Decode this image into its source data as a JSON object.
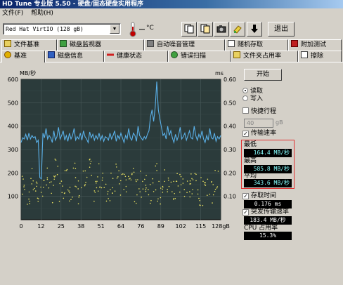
{
  "window": {
    "title": "HD Tune 专业版 5.50 - 硬盘/固态硬盘实用程序"
  },
  "menu": [
    "文件(F)",
    "帮助(H)"
  ],
  "toolbar": {
    "drive": "Red Hat VirtIO (128 gB)",
    "temp_unit": "°C",
    "exit_label": "退出",
    "icons": [
      "copy-info-icon",
      "copy-screenshot-icon",
      "camera-icon",
      "save-icon",
      "download-icon"
    ]
  },
  "tabs_top": [
    "文件基准",
    "磁盘监视器",
    "自动噪音管理",
    "随机存取",
    "附加测试"
  ],
  "tabs_bottom": [
    "基准",
    "磁盘信息",
    "健康状态",
    "错误扫描",
    "文件夹占用率",
    "擦除"
  ],
  "controls": {
    "start_label": "开始",
    "read_label": "读取",
    "write_label": "写入",
    "short_stroke_label": "快捷行程",
    "short_stroke_value": "40",
    "short_stroke_unit": "gB",
    "transfer_rate_label": "传输速率",
    "min_label": "最低",
    "min_value": "164.4 MB/秒",
    "max_label": "最高",
    "max_value": "585.8 MB/秒",
    "avg_label": "平均",
    "avg_value": "343.6 MB/秒",
    "access_time_label": "存取时间",
    "access_time_value": "0.176 ms",
    "burst_rate_label": "突发传输速率",
    "burst_rate_value": "183.4 MB/秒",
    "cpu_label": "CPU 占用率",
    "cpu_value": "15.3%"
  },
  "chart_data": {
    "type": "line",
    "xlabel": "",
    "ylabel": "MB/秒",
    "ylabel_right": "ms",
    "x_unit": "gB",
    "xlim": [
      0,
      128
    ],
    "ylim": [
      0,
      600
    ],
    "y2lim": [
      0,
      0.6
    ],
    "x_ticks": [
      "0",
      "12",
      "25",
      "38",
      "51",
      "64",
      "76",
      "89",
      "102",
      "115",
      "128gB"
    ],
    "y_ticks": [
      "600",
      "500",
      "400",
      "300",
      "200",
      "100"
    ],
    "y2_ticks": [
      "0.60",
      "0.50",
      "0.40",
      "0.30",
      "0.20",
      "0.10"
    ],
    "grid": true,
    "background": "#2b3b3b",
    "series": [
      {
        "color": "#5ab0e8",
        "x": [
          0,
          1,
          2,
          3,
          4,
          5,
          6,
          7,
          8,
          9,
          10,
          11,
          12,
          13,
          14,
          15,
          16,
          17,
          18,
          19,
          20,
          21,
          22,
          23,
          24,
          25,
          26,
          27,
          28,
          29,
          30,
          31,
          32,
          33,
          34,
          35,
          36,
          37,
          38,
          39,
          40,
          41,
          42,
          43,
          44,
          45,
          46,
          47,
          48,
          49,
          50,
          51,
          52,
          53,
          54,
          55,
          56,
          57,
          58,
          59,
          60,
          61,
          62,
          63,
          64,
          65,
          66,
          67,
          68,
          69,
          70,
          71,
          72,
          73,
          74,
          75,
          76,
          77,
          78,
          79,
          80,
          81,
          82,
          83,
          84,
          85,
          86,
          87,
          88,
          89,
          90,
          91,
          92,
          93,
          94,
          95,
          96,
          97,
          98,
          99,
          100,
          101,
          102,
          103,
          104,
          105,
          106,
          107,
          108,
          109,
          110,
          111,
          112,
          113,
          114,
          115,
          116,
          117,
          118,
          119,
          120,
          121,
          122,
          123,
          124,
          125,
          126,
          127,
          128
        ],
        "values": [
          330,
          350,
          345,
          365,
          340,
          370,
          345,
          360,
          350,
          355,
          330,
          340,
          180,
          175,
          370,
          350,
          390,
          345,
          360,
          350,
          330,
          380,
          340,
          355,
          395,
          345,
          360,
          380,
          340,
          360,
          335,
          370,
          345,
          360,
          390,
          340,
          355,
          345,
          370,
          340,
          380,
          355,
          345,
          330,
          375,
          350,
          365,
          340,
          360,
          345,
          370,
          340,
          360,
          335,
          355,
          350,
          340,
          370,
          345,
          360,
          380,
          335,
          360,
          345,
          370,
          350,
          330,
          360,
          345,
          390,
          350,
          340,
          370,
          360,
          335,
          400,
          360,
          350,
          340,
          355,
          345,
          365,
          380,
          440,
          470,
          420,
          480,
          590,
          470,
          430,
          395,
          360,
          370,
          345,
          400,
          360,
          380,
          350,
          330,
          365,
          340,
          360,
          395,
          345,
          355,
          370,
          340,
          360,
          380,
          350,
          345,
          400,
          360,
          340,
          365,
          350,
          380,
          345,
          330,
          360,
          340,
          390,
          350,
          345,
          370,
          335,
          355,
          345,
          360
        ]
      },
      {
        "color": "#e8e060",
        "marker": "dots",
        "y_axis": "right",
        "x": [
          2,
          5,
          8,
          11,
          14,
          17,
          20,
          23,
          26,
          29,
          32,
          35,
          38,
          41,
          44,
          47,
          50,
          53,
          56,
          59,
          62,
          65,
          68,
          71,
          74,
          77,
          80,
          83,
          86,
          89,
          92,
          95,
          98,
          101,
          104,
          107,
          110,
          113,
          116,
          119,
          122,
          125
        ],
        "values": [
          0.14,
          0.12,
          0.16,
          0.11,
          0.15,
          0.18,
          0.13,
          0.2,
          0.12,
          0.17,
          0.14,
          0.19,
          0.12,
          0.16,
          0.2,
          0.13,
          0.18,
          0.15,
          0.12,
          0.17,
          0.21,
          0.14,
          0.16,
          0.19,
          0.12,
          0.15,
          0.17,
          0.13,
          0.18,
          0.11,
          0.16,
          0.14,
          0.12,
          0.17,
          0.15,
          0.13,
          0.16,
          0.14,
          0.12,
          0.15,
          0.13,
          0.16
        ]
      }
    ]
  }
}
